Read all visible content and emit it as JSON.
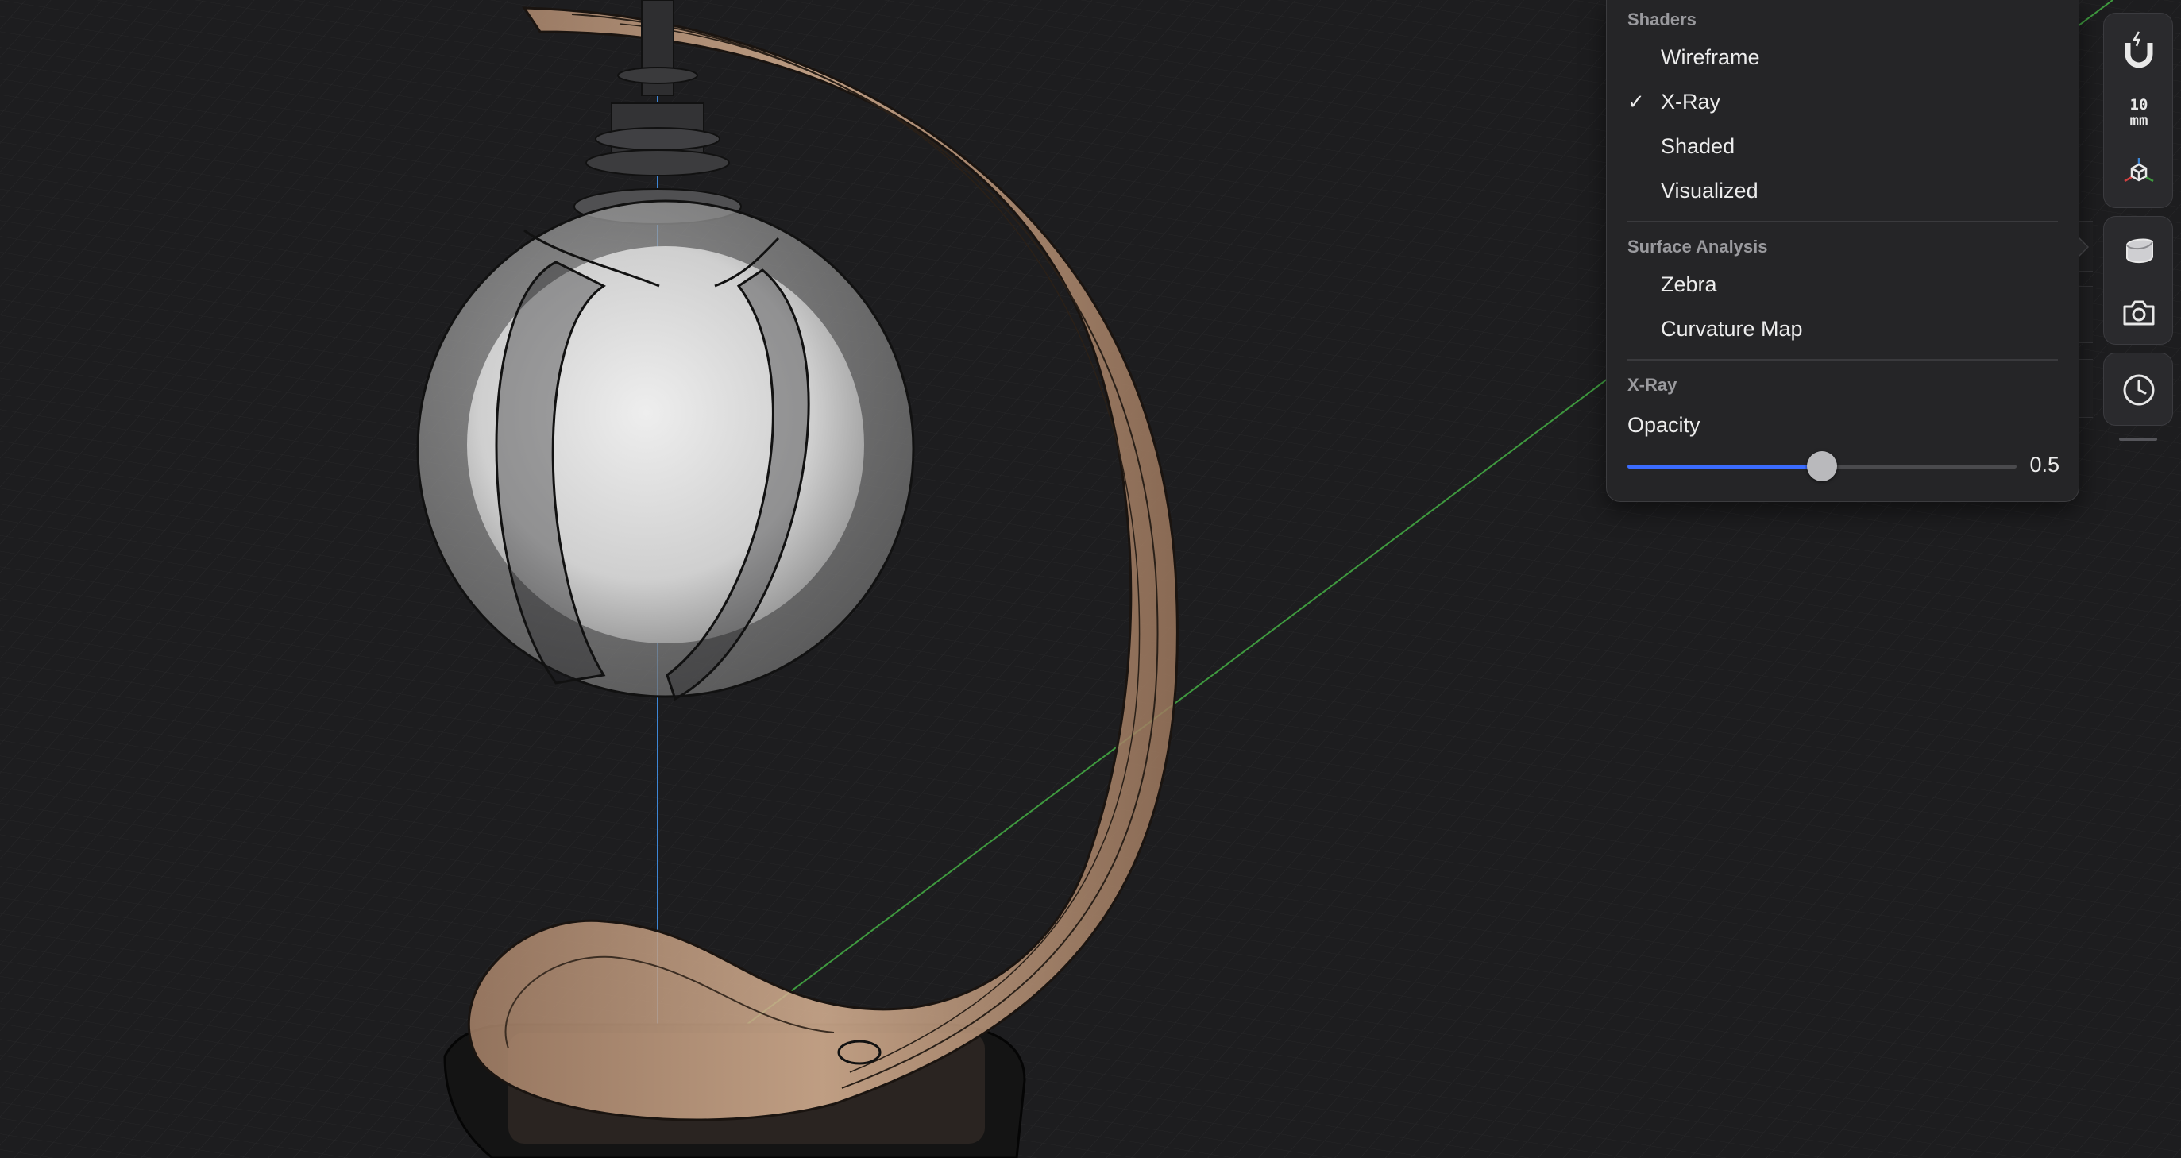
{
  "popover": {
    "shaders_title": "Shaders",
    "shaders": [
      {
        "label": "Wireframe",
        "checked": false
      },
      {
        "label": "X-Ray",
        "checked": true
      },
      {
        "label": "Shaded",
        "checked": false
      },
      {
        "label": "Visualized",
        "checked": false
      }
    ],
    "check_glyph": "✓",
    "surface_title": "Surface Analysis",
    "surface": [
      {
        "label": "Zebra"
      },
      {
        "label": "Curvature Map"
      }
    ],
    "xray_title": "X-Ray",
    "opacity_label": "Opacity",
    "opacity_value": 0.5,
    "opacity_text": "0.5",
    "accent": "#3b6cff"
  },
  "toolbar": {
    "snap_icon": "magnet-icon",
    "grid_value": "10",
    "grid_unit": "mm",
    "view_cube_icon": "view-cube-icon",
    "shading_icon": "shading-sphere-icon",
    "camera_icon": "camera-icon",
    "history_icon": "clock-icon"
  }
}
